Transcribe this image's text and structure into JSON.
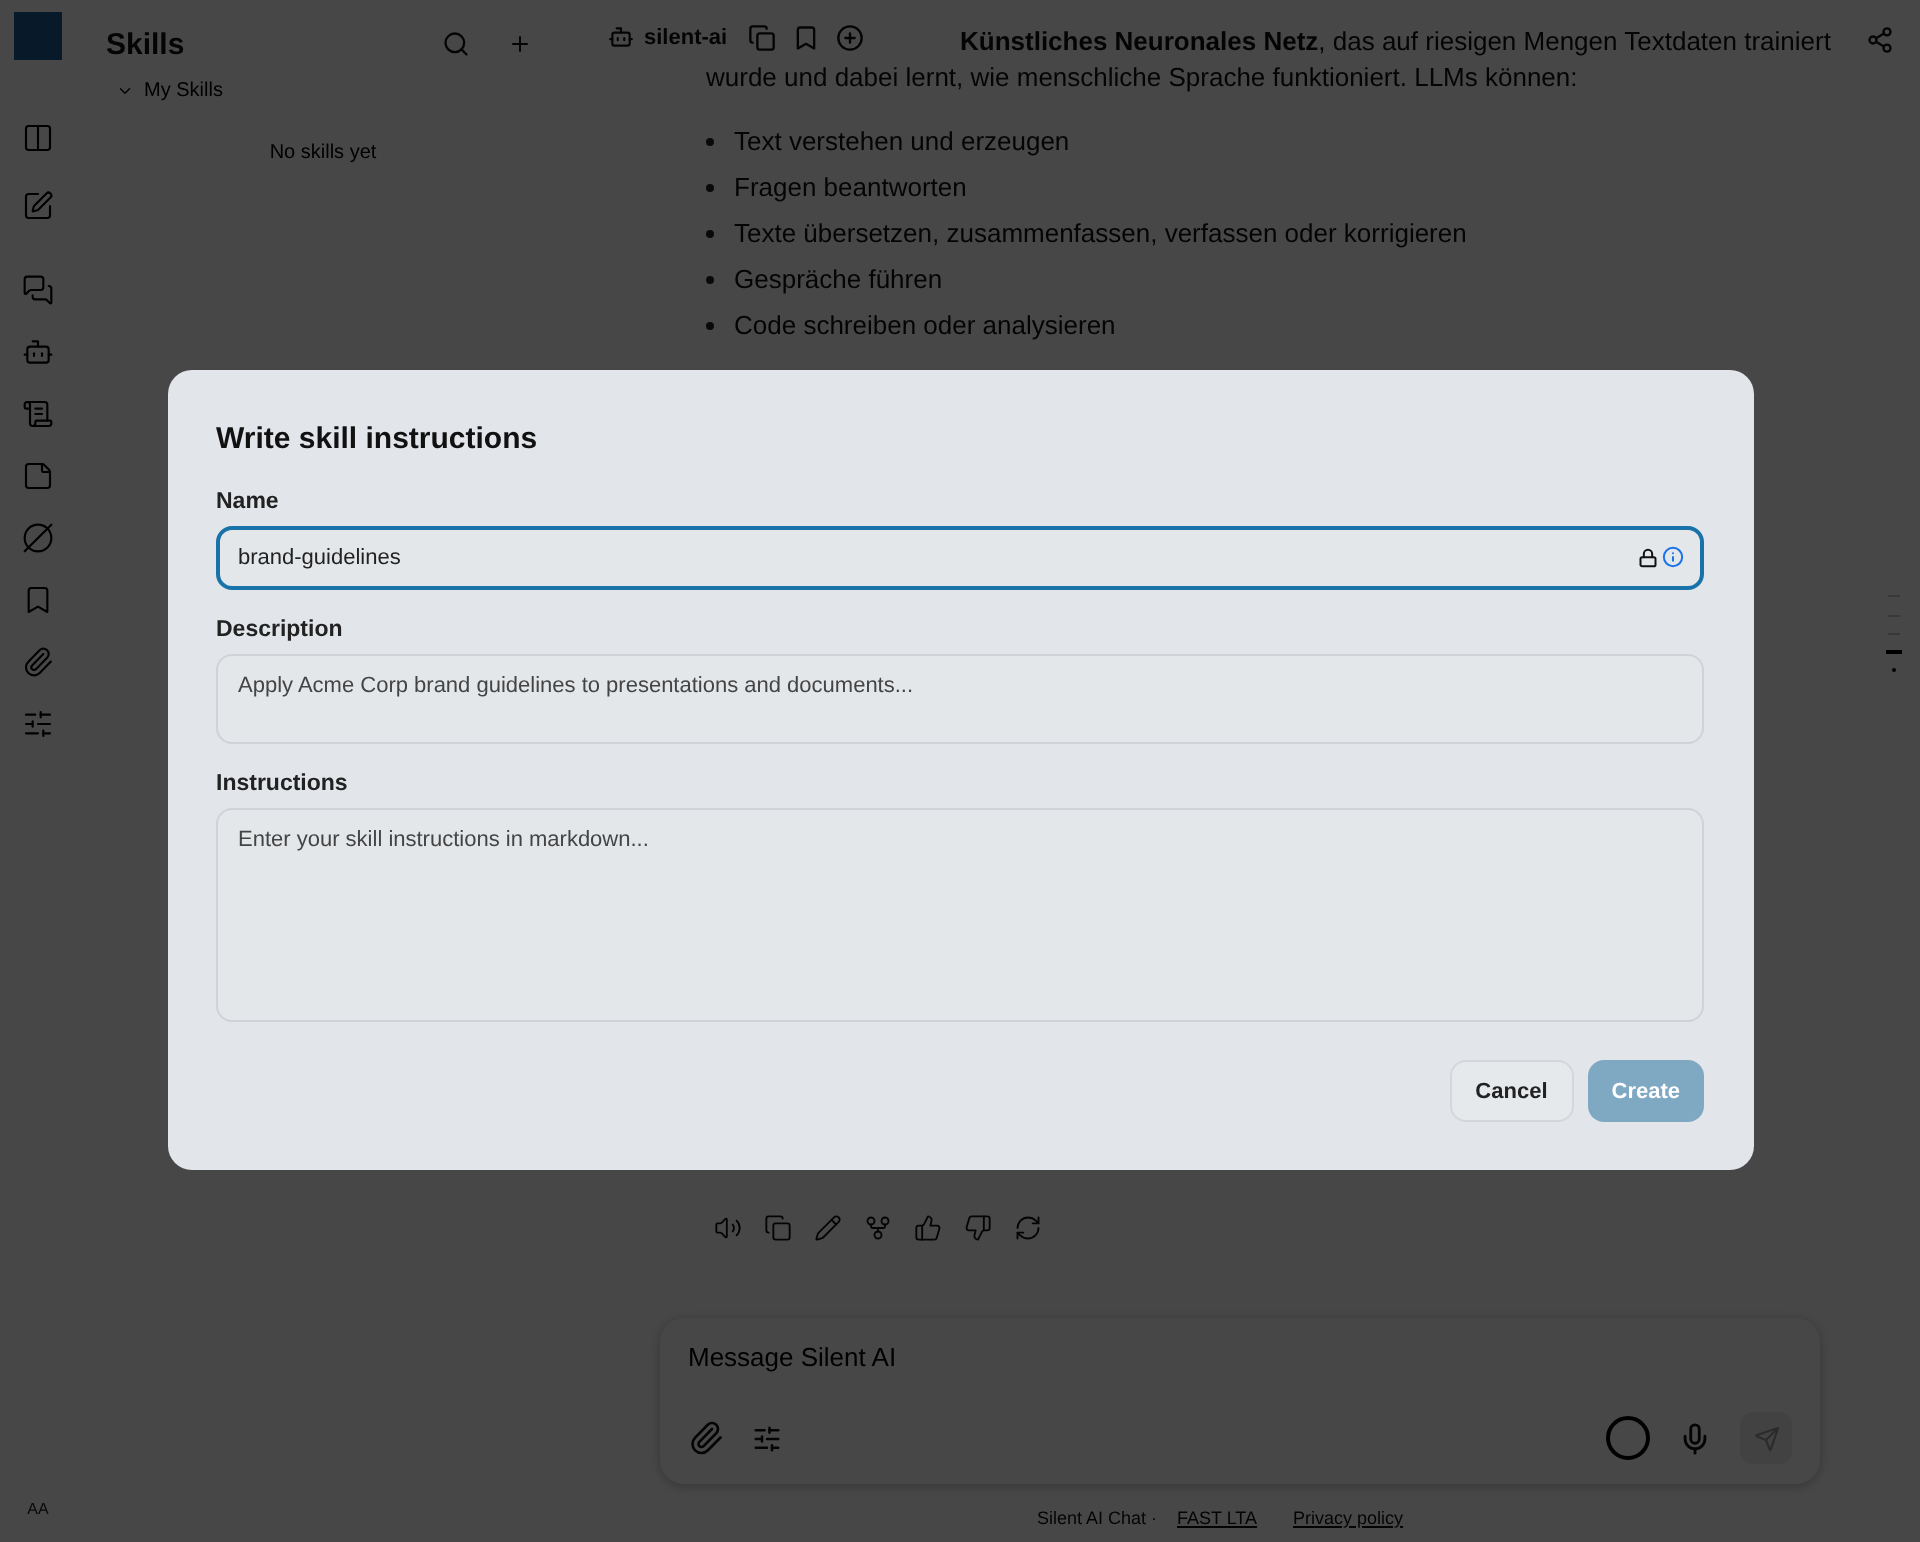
{
  "rail": {
    "footer_text": "AA"
  },
  "sidebar": {
    "title": "Skills",
    "group": {
      "label": "My Skills",
      "expanded": true
    },
    "empty_text": "No skills yet"
  },
  "toolbar": {
    "chip": "silent-ai"
  },
  "message": {
    "lines": [
      "**Künstliches Neuronales Netz**, das auf riesigen Mengen Textdaten trainiert",
      "wurde und dabei lernt, wie menschliche Sprache funktioniert. LLMs können:"
    ],
    "bullets": [
      "Text verstehen und erzeugen",
      "Fragen beantworten",
      "Texte übersetzen, zusammenfassen, verfassen oder korrigieren",
      "Gespräche führen",
      "Code schreiben oder analysieren"
    ]
  },
  "composer": {
    "placeholder": "Message Silent AI"
  },
  "footer": {
    "text": "Silent AI Chat ·",
    "links": [
      "FAST LTA",
      "Privacy policy"
    ]
  },
  "dialog": {
    "title": "Write skill instructions",
    "fields": [
      {
        "label": "Name",
        "kind": "input",
        "value": "brand-guidelines",
        "focused": true
      },
      {
        "label": "Description",
        "kind": "textarea",
        "placeholder": "Apply Acme Corp brand guidelines to presentations and documents...",
        "focused": false
      },
      {
        "label": "Instructions",
        "kind": "textarea",
        "placeholder": "Enter your skill instructions in markdown...",
        "focused": false
      }
    ],
    "buttons": [
      {
        "label": "Cancel",
        "kind": "secondary"
      },
      {
        "label": "Create",
        "kind": "primary",
        "disabled": true
      }
    ]
  }
}
